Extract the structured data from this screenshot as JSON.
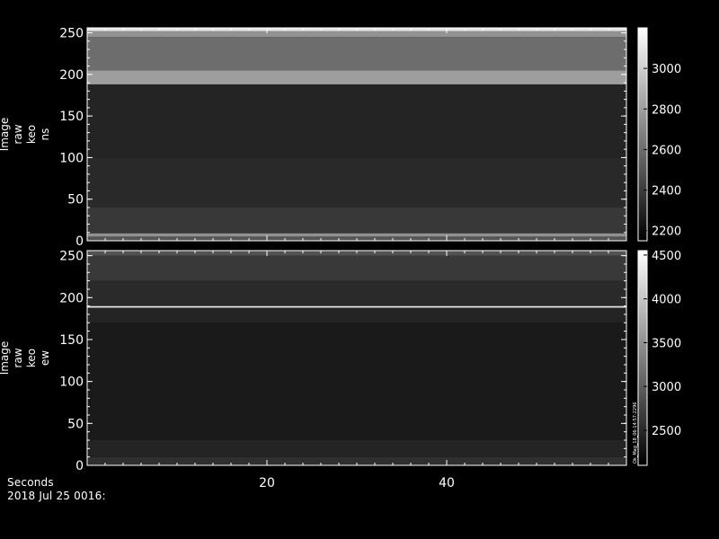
{
  "chart_data": [
    {
      "type": "heatmap",
      "panel": "ns",
      "ylabel_lines": [
        "Image",
        "raw",
        "keo",
        "ns"
      ],
      "ylim": [
        0,
        256
      ],
      "yticks": [
        0,
        50,
        100,
        150,
        200,
        250
      ],
      "xlim": [
        0,
        60
      ],
      "xticks": [
        20,
        40
      ],
      "colorbar": {
        "min": 2150,
        "max": 3200,
        "ticks": [
          2200,
          2400,
          2600,
          2800,
          3000
        ]
      },
      "bands": [
        {
          "y0": 0,
          "y1": 5,
          "value": 2500
        },
        {
          "y0": 5,
          "y1": 9,
          "value": 2750
        },
        {
          "y0": 9,
          "y1": 40,
          "value": 2380
        },
        {
          "y0": 40,
          "y1": 100,
          "value": 2320
        },
        {
          "y0": 100,
          "y1": 188,
          "value": 2300
        },
        {
          "y0": 188,
          "y1": 205,
          "value": 2800
        },
        {
          "y0": 205,
          "y1": 245,
          "value": 2600
        },
        {
          "y0": 245,
          "y1": 252,
          "value": 2750
        },
        {
          "y0": 252,
          "y1": 256,
          "value": 3100
        }
      ]
    },
    {
      "type": "heatmap",
      "panel": "ew",
      "ylabel_lines": [
        "Image",
        "raw",
        "keo",
        "ew"
      ],
      "ylim": [
        0,
        256
      ],
      "yticks": [
        0,
        50,
        100,
        150,
        200,
        250
      ],
      "xlim": [
        0,
        60
      ],
      "xticks": [
        20,
        40
      ],
      "colorbar": {
        "min": 2100,
        "max": 4550,
        "ticks": [
          2500,
          3000,
          3500,
          4000,
          4500
        ]
      },
      "colorbar_note": "Ok_Mag_18_06-14-57-2296",
      "bands": [
        {
          "y0": 0,
          "y1": 10,
          "value": 2550
        },
        {
          "y0": 10,
          "y1": 30,
          "value": 2450
        },
        {
          "y0": 30,
          "y1": 170,
          "value": 2350
        },
        {
          "y0": 170,
          "y1": 188,
          "value": 2450
        },
        {
          "y0": 188,
          "y1": 190,
          "value": 4300
        },
        {
          "y0": 190,
          "y1": 220,
          "value": 2500
        },
        {
          "y0": 220,
          "y1": 250,
          "value": 2650
        },
        {
          "y0": 250,
          "y1": 256,
          "value": 2900
        }
      ]
    }
  ],
  "footer": {
    "xunit": "Seconds",
    "date": "2018 Jul 25 0016:"
  }
}
